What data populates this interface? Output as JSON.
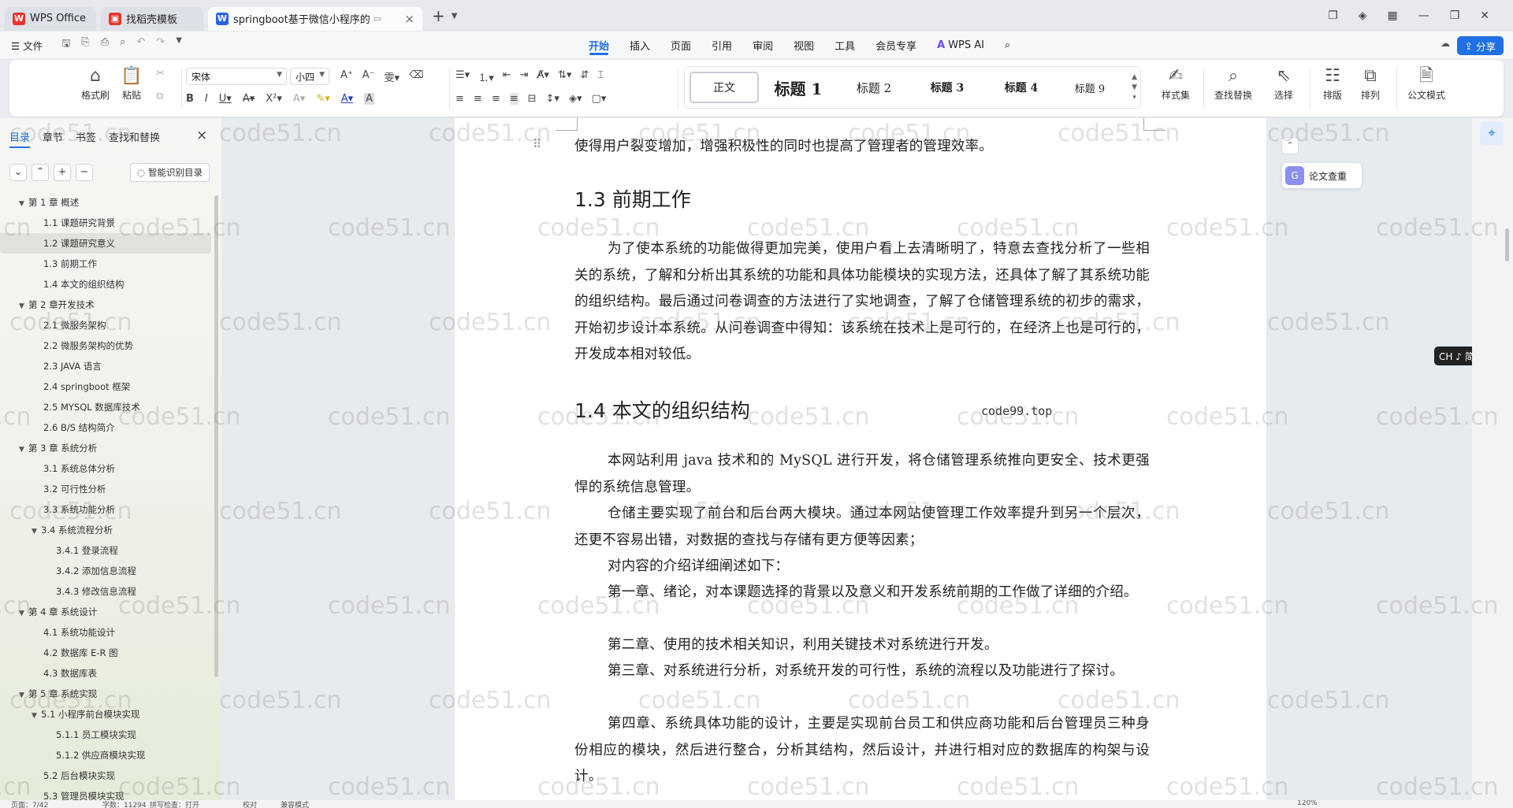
{
  "titlebar": {
    "tabs": [
      {
        "label": "WPS Office",
        "icon": "wps-logo-icon",
        "color": "#e8342c"
      },
      {
        "label": "找稻壳模板",
        "icon": "docer-icon",
        "color": "#e8342c"
      },
      {
        "label": "springboot基于微信小程序的",
        "icon": "word-doc-icon",
        "color": "#2b63e6"
      }
    ],
    "new_tab": "+"
  },
  "menubar": {
    "file_label": "文件",
    "ribbon_tabs": [
      "开始",
      "插入",
      "页面",
      "引用",
      "审阅",
      "视图",
      "工具",
      "会员专享"
    ],
    "active_tab": "开始",
    "wps_ai": "WPS AI",
    "share_label": "分享"
  },
  "toolbar": {
    "format_painter": "格式刷",
    "paste": "粘贴",
    "font_name": "宋体",
    "font_size": "小四",
    "styles": [
      "正文",
      "标题 1",
      "标题 2",
      "标题 3",
      "标题 4",
      "标题 9"
    ],
    "style_set": "样式集",
    "find_replace": "查找替换",
    "select": "选择",
    "layout": "排版",
    "arrange": "排列",
    "official_mode": "公文模式"
  },
  "sidebar": {
    "tabs": [
      "目录",
      "章节",
      "书签",
      "查找和替换"
    ],
    "smart_toc": "智能识别目录",
    "toc": [
      {
        "label": "第 1 章 概述",
        "level": 1,
        "expanded": true
      },
      {
        "label": "1.1 课题研究背景",
        "level": 2
      },
      {
        "label": "1.2 课题研究意义",
        "level": 2,
        "selected": true
      },
      {
        "label": "1.3 前期工作",
        "level": 2
      },
      {
        "label": "1.4 本文的组织结构",
        "level": 2
      },
      {
        "label": "第 2 章开发技术",
        "level": 1,
        "expanded": true
      },
      {
        "label": "2.1 微服务架构",
        "level": 2
      },
      {
        "label": "2.2 微服务架构的优势",
        "level": 2
      },
      {
        "label": "2.3 JAVA 语言",
        "level": 2
      },
      {
        "label": "2.4 springboot 框架",
        "level": 2
      },
      {
        "label": "2.5 MYSQL 数据库技术",
        "level": 2
      },
      {
        "label": "2.6 B/S 结构简介",
        "level": 2
      },
      {
        "label": "第 3 章 系统分析",
        "level": 1,
        "expanded": true
      },
      {
        "label": "3.1 系统总体分析",
        "level": 2
      },
      {
        "label": "3.2 可行性分析",
        "level": 2
      },
      {
        "label": "3.3 系统功能分析",
        "level": 2
      },
      {
        "label": "3.4 系统流程分析",
        "level": 2,
        "expanded": true
      },
      {
        "label": "3.4.1 登录流程",
        "level": 3
      },
      {
        "label": "3.4.2 添加信息流程",
        "level": 3
      },
      {
        "label": "3.4.3 修改信息流程",
        "level": 3
      },
      {
        "label": "第 4 章 系统设计",
        "level": 1,
        "expanded": true
      },
      {
        "label": "4.1 系统功能设计",
        "level": 2
      },
      {
        "label": "4.2 数据库 E-R 图",
        "level": 2
      },
      {
        "label": "4.3 数据库表",
        "level": 2
      },
      {
        "label": "第 5 章 系统实现",
        "level": 1,
        "expanded": true
      },
      {
        "label": "5.1 小程序前台模块实现",
        "level": 2,
        "expanded": true
      },
      {
        "label": "5.1.1 员工模块实现",
        "level": 3
      },
      {
        "label": "5.1.2 供应商模块实现",
        "level": 3
      },
      {
        "label": "5.2 后台模块实现",
        "level": 2
      },
      {
        "label": "5.3 管理员模块实现",
        "level": 2
      }
    ]
  },
  "document": {
    "first_line": "使得用户裂变增加，增强积极性的同时也提高了管理者的管理效率。",
    "h13": "1.3 前期工作",
    "p13": "为了使本系统的功能做得更加完美，使用户看上去清晰明了，特意去查找分析了一些相关的系统，了解和分析出其系统的功能和具体功能模块的实现方法，还具体了解了其系统功能的组织结构。最后通过问卷调查的方法进行了实地调查，了解了仓储管理系统的初步的需求，开始初步设计本系统。从问卷调查中得知：该系统在技术上是可行的，在经济上也是可行的，开发成本相对较低。",
    "h14": "1.4 本文的组织结构",
    "overlay": "code99.top",
    "paras": [
      "本网站利用 java 技术和的 MySQL 进行开发，将仓储管理系统推向更安全、技术更强悍的系统信息管理。",
      "仓储主要实现了前台和后台两大模块。通过本网站使管理工作效率提升到另一个层次，还更不容易出错，对数据的查找与存储有更方便等因素；",
      "对内容的介绍详细阐述如下：",
      "第一章、绪论，对本课题选择的背景以及意义和开发系统前期的工作做了详细的介绍。",
      "第二章、使用的技术相关知识，利用关键技术对系统进行开发。",
      "第三章、对系统进行分析，对系统开发的可行性，系统的流程以及功能进行了探讨。",
      "第四章、系统具体功能的设计，主要是实现前台员工和供应商功能和后台管理员三种身份相应的模块，然后进行整合，分析其结构，然后设计，并进行相对应的数据库的构架与设计。"
    ]
  },
  "watermark": "code51.cn",
  "right_panel": {
    "paper_check": "论文查重",
    "ime_badge": "CH ♪ 简"
  },
  "statusbar": {
    "page": "页面：7/42",
    "words": "字数：11294",
    "spell": "拼写检查：打开",
    "proof": "校对",
    "compat": "兼容模式",
    "zoom": "120%"
  }
}
